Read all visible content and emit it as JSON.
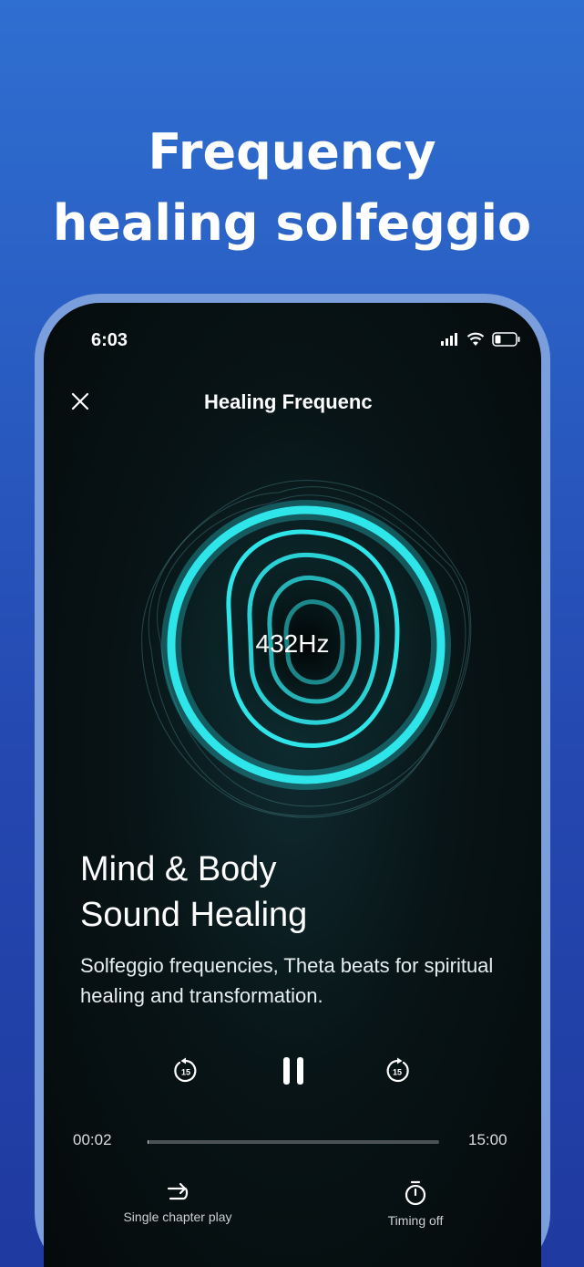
{
  "promo": {
    "line1": "Frequency",
    "line2": "healing solfeggio"
  },
  "status": {
    "time": "6:03"
  },
  "nav": {
    "title": "Healing Frequenc"
  },
  "player": {
    "frequency": "432Hz",
    "title_line1": "Mind & Body",
    "title_line2": "Sound Healing",
    "description": "Solfeggio frequencies, Theta beats for spiritual healing and transformation.",
    "rewind_label": "15",
    "forward_label": "15",
    "current_time": "00:02",
    "total_time": "15:00",
    "progress": 0.002
  },
  "bottom": {
    "repeat_label": "Single chapter play",
    "timer_label": "Timing off"
  },
  "colors": {
    "accent": "#2ee6ea",
    "background_top": "#2f6fd0",
    "frame": "#7b9fdc"
  }
}
